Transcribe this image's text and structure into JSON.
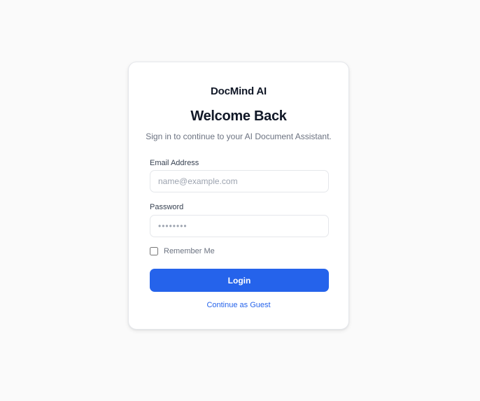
{
  "brand": {
    "name": "DocMind AI"
  },
  "header": {
    "title": "Welcome Back",
    "subtitle": "Sign in to continue to your AI Document Assistant."
  },
  "form": {
    "email": {
      "label": "Email Address",
      "placeholder": "name@example.com",
      "value": ""
    },
    "password": {
      "label": "Password",
      "placeholder": "••••••••",
      "value": ""
    },
    "remember": {
      "label": "Remember Me",
      "checked": false
    },
    "login_label": "Login",
    "guest_label": "Continue as Guest"
  },
  "colors": {
    "accent": "#2563eb",
    "background": "#fafafa",
    "card": "#ffffff",
    "text_primary": "#111827",
    "text_muted": "#6b7280"
  }
}
